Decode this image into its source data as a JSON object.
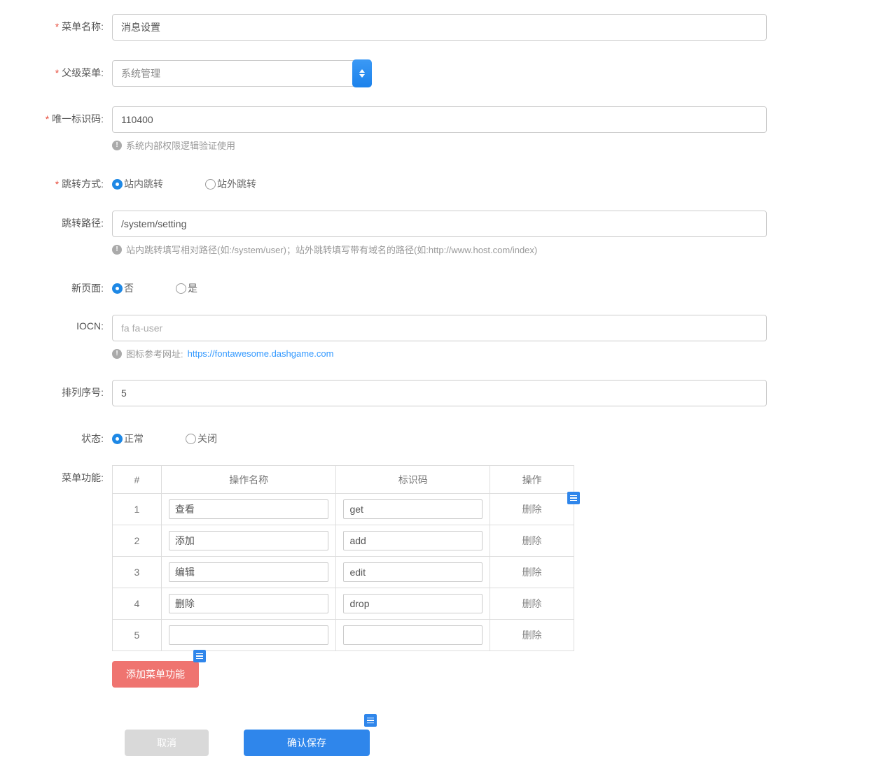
{
  "fields": {
    "menuName": {
      "label": "菜单名称:",
      "value": "消息设置"
    },
    "parentMenu": {
      "label": "父级菜单:",
      "selected": "系统管理"
    },
    "uniqueCode": {
      "label": "唯一标识码:",
      "value": "110400",
      "help": "系统内部权限逻辑验证使用"
    },
    "jumpType": {
      "label": "跳转方式:",
      "options": {
        "internal": "站内跳转",
        "external": "站外跳转"
      }
    },
    "jumpPath": {
      "label": "跳转路径:",
      "value": "/system/setting",
      "help": "站内跳转填写相对路径(如:/system/user)；站外跳转填写带有域名的路径(如:http://www.host.com/index)"
    },
    "newPage": {
      "label": "新页面:",
      "options": {
        "no": "否",
        "yes": "是"
      }
    },
    "icon": {
      "label": "IOCN:",
      "placeholder": "fa fa-user",
      "helpPrefix": "图标参考网址:",
      "helpLink": "https://fontawesome.dashgame.com"
    },
    "sortOrder": {
      "label": "排列序号:",
      "value": "5"
    },
    "status": {
      "label": "状态:",
      "options": {
        "normal": "正常",
        "closed": "关闭"
      }
    },
    "menuFunc": {
      "label": "菜单功能:"
    }
  },
  "table": {
    "headers": {
      "num": "#",
      "name": "操作名称",
      "code": "标识码",
      "action": "操作"
    },
    "deleteLabel": "删除",
    "rows": [
      {
        "num": "1",
        "name": "查看",
        "code": "get"
      },
      {
        "num": "2",
        "name": "添加",
        "code": "add"
      },
      {
        "num": "3",
        "name": "编辑",
        "code": "edit"
      },
      {
        "num": "4",
        "name": "删除",
        "code": "drop"
      },
      {
        "num": "5",
        "name": "",
        "code": ""
      }
    ]
  },
  "buttons": {
    "addFunc": "添加菜单功能",
    "cancel": "取消",
    "save": "确认保存"
  }
}
